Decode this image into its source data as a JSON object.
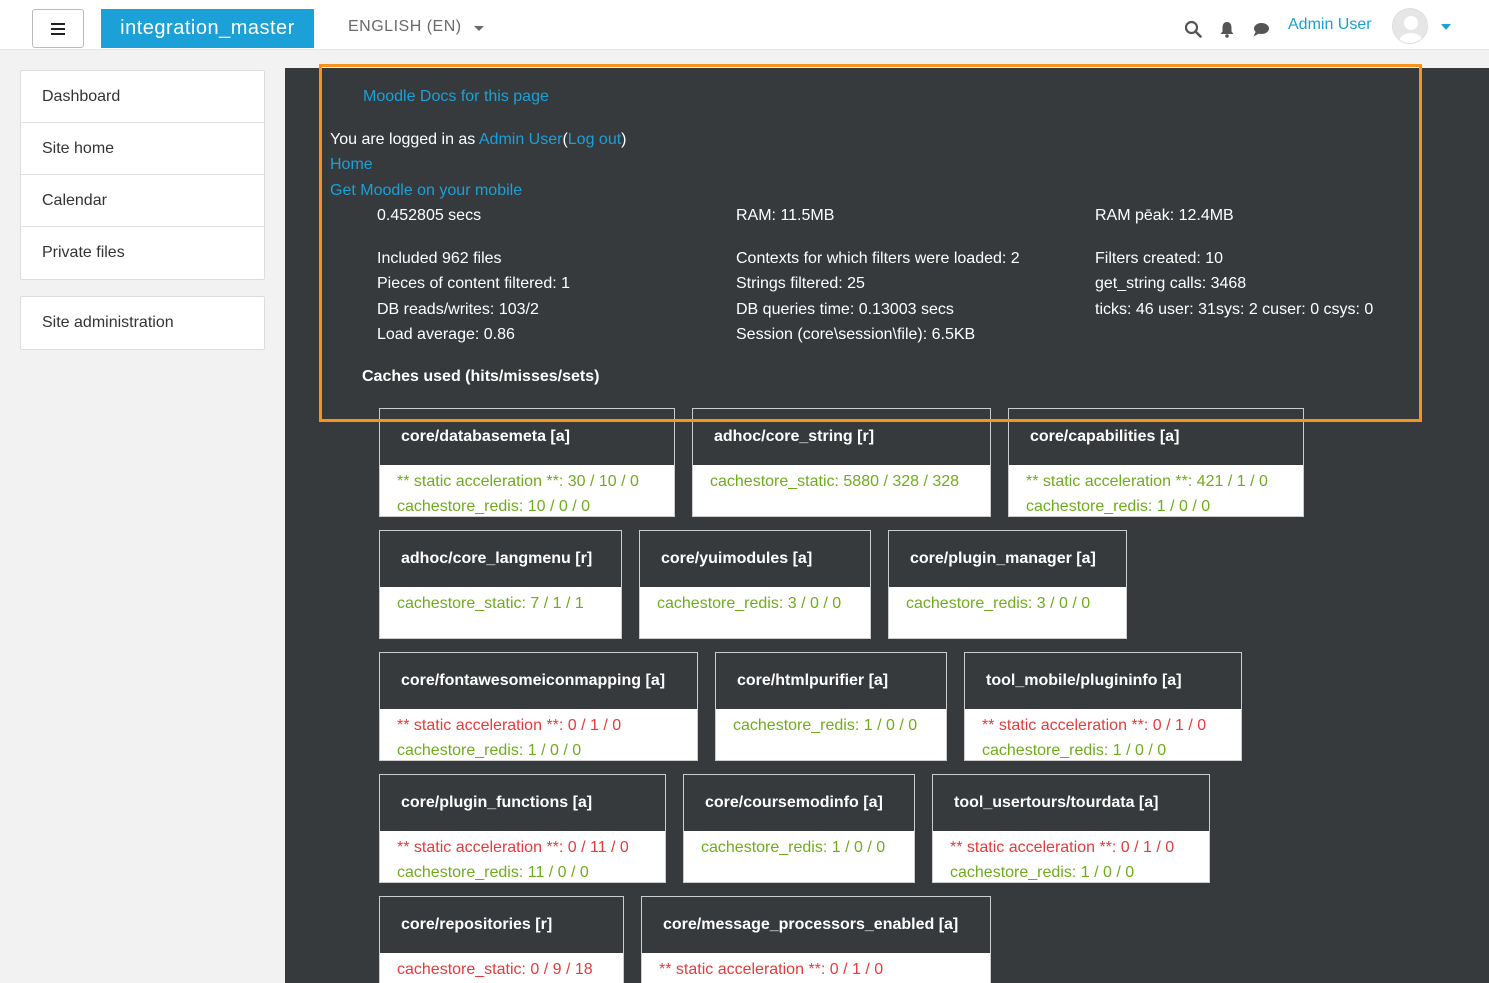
{
  "header": {
    "brand": "integration_master",
    "language": "ENGLISH (EN)",
    "user_name": "Admin User",
    "colors": {
      "brand": "#1ba0d7",
      "accent_link": "#1ba0d7"
    }
  },
  "sidebar": {
    "items": [
      "Dashboard",
      "Site home",
      "Calendar",
      "Private files"
    ],
    "admin_item": "Site administration"
  },
  "footer": {
    "docs_link": "Moodle Docs for this page",
    "logged_in_prefix": "You are logged in as",
    "logged_in_user": "Admin User",
    "open_paren": "(",
    "logout": "Log out",
    "close_paren": ")",
    "home": "Home",
    "mobile": "Get Moodle on your mobile"
  },
  "perf": {
    "col1": [
      "0.452805 secs",
      "Included 962 files",
      "Pieces of content filtered: 1",
      "DB reads/writes: 103/2",
      "Load average: 0.86"
    ],
    "col2": [
      "RAM: 11.5MB",
      "Contexts for which filters were loaded: 2",
      "Strings filtered: 25",
      "DB queries time: 0.13003 secs",
      "Session (core\\session\\file): 6.5KB"
    ],
    "col3": [
      "RAM pēak: 12.4MB",
      "Filters created: 10",
      "get_string calls: 3468",
      "ticks: 46 user: 31sys: 2 cuser: 0 csys: 0"
    ]
  },
  "caches": {
    "title": "Caches used (hits/misses/sets)",
    "cards": [
      {
        "name": "core/databasemeta [a]",
        "stats": [
          {
            "text": "** static acceleration **: 30 / 10 / 0",
            "status": "good"
          },
          {
            "text": "cachestore_redis: 10 / 0 / 0",
            "status": "good"
          }
        ]
      },
      {
        "name": "adhoc/core_string [r]",
        "stats": [
          {
            "text": "cachestore_static: 5880 / 328 / 328",
            "status": "good"
          }
        ]
      },
      {
        "name": "core/capabilities [a]",
        "stats": [
          {
            "text": "** static acceleration **: 421 / 1 / 0",
            "status": "good"
          },
          {
            "text": "cachestore_redis: 1 / 0 / 0",
            "status": "good"
          }
        ]
      },
      {
        "name": "adhoc/core_langmenu [r]",
        "stats": [
          {
            "text": "cachestore_static: 7 / 1 / 1",
            "status": "good"
          }
        ]
      },
      {
        "name": "core/yuimodules [a]",
        "stats": [
          {
            "text": "cachestore_redis: 3 / 0 / 0",
            "status": "good"
          }
        ]
      },
      {
        "name": "core/plugin_manager [a]",
        "stats": [
          {
            "text": "cachestore_redis: 3 / 0 / 0",
            "status": "good"
          }
        ]
      },
      {
        "name": "core/fontawesomeiconmapping [a]",
        "stats": [
          {
            "text": "** static acceleration **: 0 / 1 / 0",
            "status": "bad"
          },
          {
            "text": "cachestore_redis: 1 / 0 / 0",
            "status": "good"
          }
        ]
      },
      {
        "name": "core/htmlpurifier [a]",
        "stats": [
          {
            "text": "cachestore_redis: 1 / 0 / 0",
            "status": "good"
          }
        ]
      },
      {
        "name": "tool_mobile/plugininfo [a]",
        "stats": [
          {
            "text": "** static acceleration **: 0 / 1 / 0",
            "status": "bad"
          },
          {
            "text": "cachestore_redis: 1 / 0 / 0",
            "status": "good"
          }
        ]
      },
      {
        "name": "core/plugin_functions [a]",
        "stats": [
          {
            "text": "** static acceleration **: 0 / 11 / 0",
            "status": "bad"
          },
          {
            "text": "cachestore_redis: 11 / 0 / 0",
            "status": "good"
          }
        ]
      },
      {
        "name": "core/coursemodinfo [a]",
        "stats": [
          {
            "text": "cachestore_redis: 1 / 0 / 0",
            "status": "good"
          }
        ]
      },
      {
        "name": "tool_usertours/tourdata [a]",
        "stats": [
          {
            "text": "** static acceleration **: 0 / 1 / 0",
            "status": "bad"
          },
          {
            "text": "cachestore_redis: 1 / 0 / 0",
            "status": "good"
          }
        ]
      },
      {
        "name": "core/repositories [r]",
        "stats": [
          {
            "text": "cachestore_static: 0 / 9 / 18",
            "status": "bad"
          }
        ]
      },
      {
        "name": "core/message_processors_enabled [a]",
        "stats": [
          {
            "text": "** static acceleration **: 0 / 1 / 0",
            "status": "bad"
          }
        ]
      }
    ],
    "colors": {
      "good": "#6fac1d",
      "bad": "#e73b3b",
      "header_bg": "#373a3c"
    }
  },
  "icons": [
    "menu-icon",
    "search-icon",
    "bell-icon",
    "chat-icon",
    "avatar-icon",
    "caret-down-icon"
  ]
}
